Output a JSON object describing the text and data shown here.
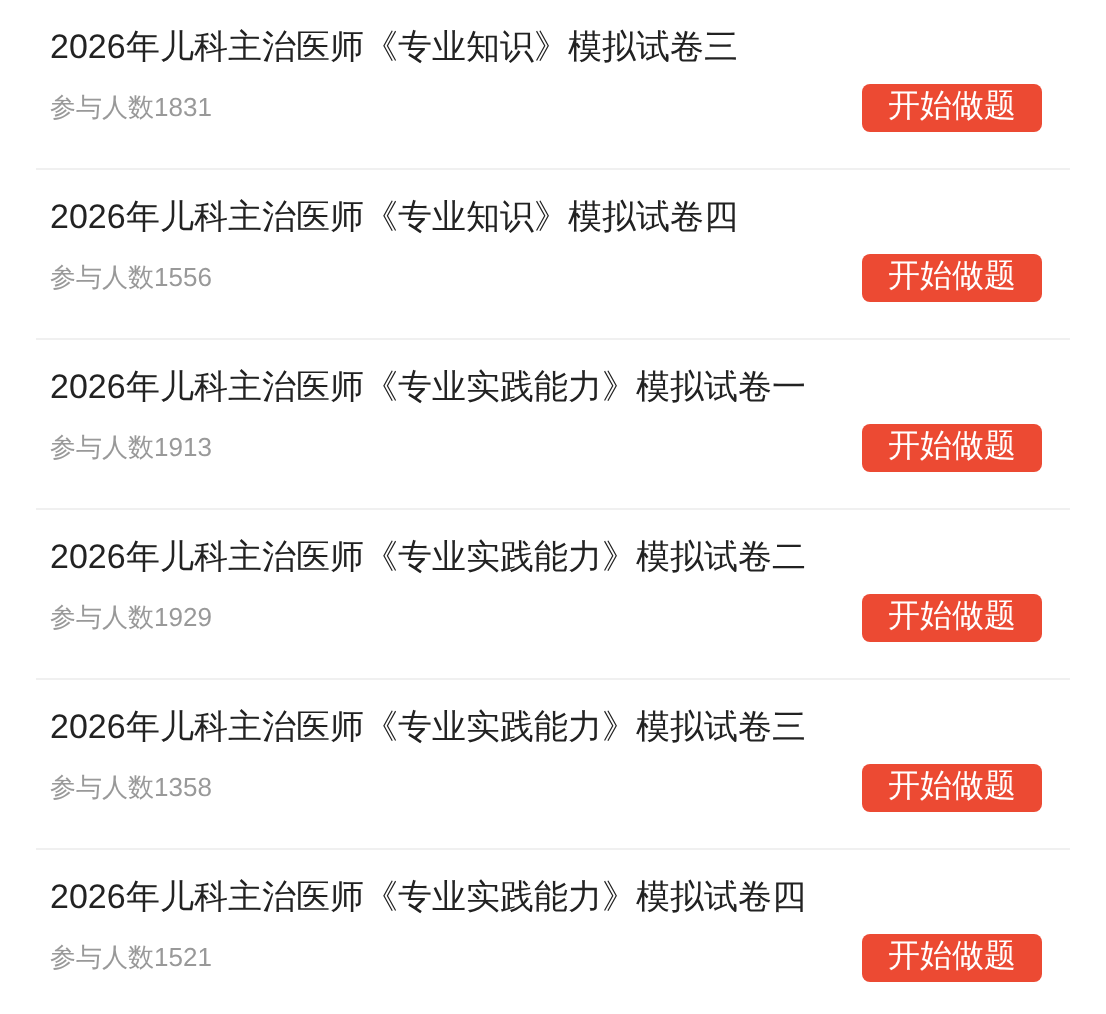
{
  "exams": [
    {
      "title": "2026年儿科主治医师《专业知识》模拟试卷三",
      "participants": "参与人数1831",
      "button": "开始做题"
    },
    {
      "title": "2026年儿科主治医师《专业知识》模拟试卷四",
      "participants": "参与人数1556",
      "button": "开始做题"
    },
    {
      "title": "2026年儿科主治医师《专业实践能力》模拟试卷一",
      "participants": "参与人数1913",
      "button": "开始做题"
    },
    {
      "title": "2026年儿科主治医师《专业实践能力》模拟试卷二",
      "participants": "参与人数1929",
      "button": "开始做题"
    },
    {
      "title": "2026年儿科主治医师《专业实践能力》模拟试卷三",
      "participants": "参与人数1358",
      "button": "开始做题"
    },
    {
      "title": "2026年儿科主治医师《专业实践能力》模拟试卷四",
      "participants": "参与人数1521",
      "button": "开始做题"
    }
  ]
}
